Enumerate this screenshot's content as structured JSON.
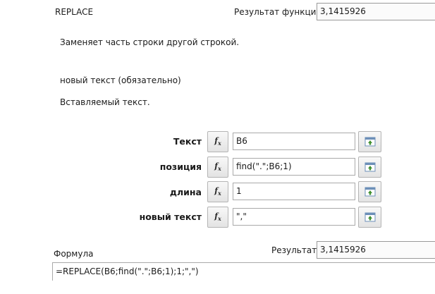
{
  "function": {
    "name": "REPLACE",
    "result_label": "Результат функции",
    "result_value": "3,1415926",
    "description": "Заменяет часть строки другой строкой."
  },
  "current_argument": {
    "name": "новый текст (обязательно)",
    "description": "Вставляемый текст."
  },
  "arguments": [
    {
      "label": "Текст",
      "value": "B6"
    },
    {
      "label": "позиция",
      "value": "find(\".\";B6;1)"
    },
    {
      "label": "длина",
      "value": "1"
    },
    {
      "label": "новый текст",
      "value": "\",\""
    }
  ],
  "formula": {
    "label": "Формула",
    "result_label": "Результат",
    "result_value": "3,1415926",
    "value": "=REPLACE(B6;find(\".\";B6;1);1;\",\")"
  },
  "icons": {
    "function_wizard": "fx-icon",
    "shrink_dialog": "shrink-icon"
  },
  "colors": {
    "shrink_icon_green": "#3f8f2f",
    "shrink_icon_frame": "#6c8fb8"
  }
}
